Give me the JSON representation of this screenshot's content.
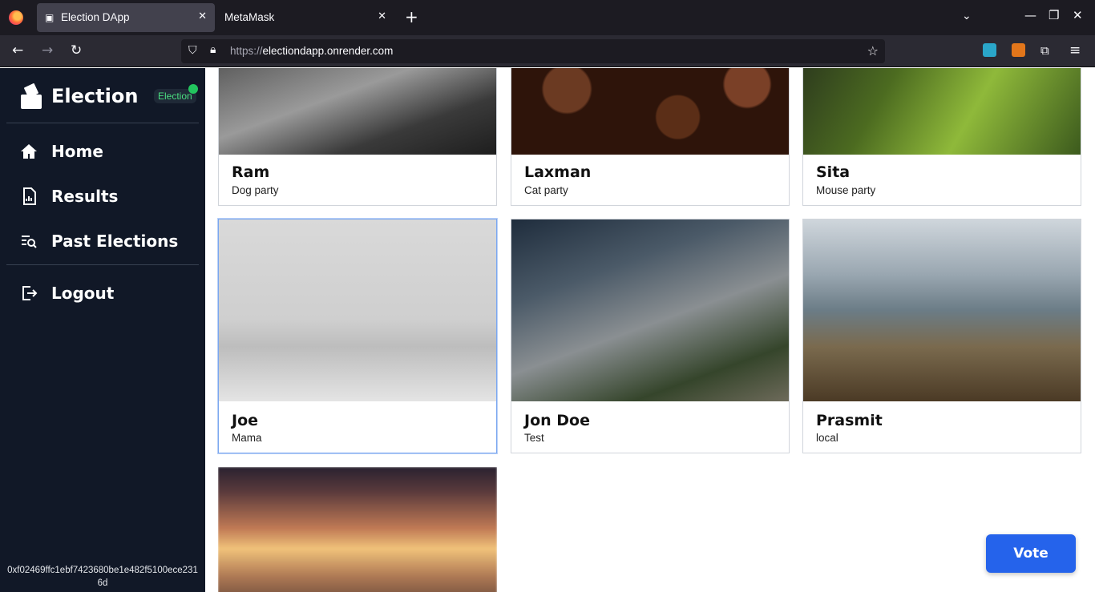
{
  "browser": {
    "tabs": [
      {
        "title": "Election DApp",
        "active": true
      },
      {
        "title": "MetaMask",
        "active": false
      }
    ],
    "url_scheme": "https://",
    "url_host": "electiondapp.onrender.com"
  },
  "sidebar": {
    "brand": "Election",
    "badge": "Election",
    "items": [
      {
        "label": "Home",
        "icon": "home-icon"
      },
      {
        "label": "Results",
        "icon": "chart-document-icon"
      },
      {
        "label": "Past Elections",
        "icon": "search-list-icon"
      },
      {
        "label": "Logout",
        "icon": "logout-icon"
      }
    ],
    "wallet_address": "0xf02469ffc1ebf7423680be1e482f5100ece2316d"
  },
  "candidates": [
    {
      "name": "Ram",
      "party": "Dog party",
      "image": "fence-landscape"
    },
    {
      "name": "Laxman",
      "party": "Cat party",
      "image": "coffee-beans"
    },
    {
      "name": "Sita",
      "party": "Mouse party",
      "image": "waterfall"
    },
    {
      "name": "Joe",
      "party": "Mama",
      "image": "desert-guitarist",
      "selected": true
    },
    {
      "name": "Jon Doe",
      "party": "Test",
      "image": "mountain-goat"
    },
    {
      "name": "Prasmit",
      "party": "local",
      "image": "mountain-lake"
    },
    {
      "name": "",
      "party": "",
      "image": "sunset-blur"
    }
  ],
  "actions": {
    "vote_label": "Vote"
  },
  "colors": {
    "sidebar_bg": "#111827",
    "accent": "#2563eb",
    "badge_green": "#22c55e"
  }
}
